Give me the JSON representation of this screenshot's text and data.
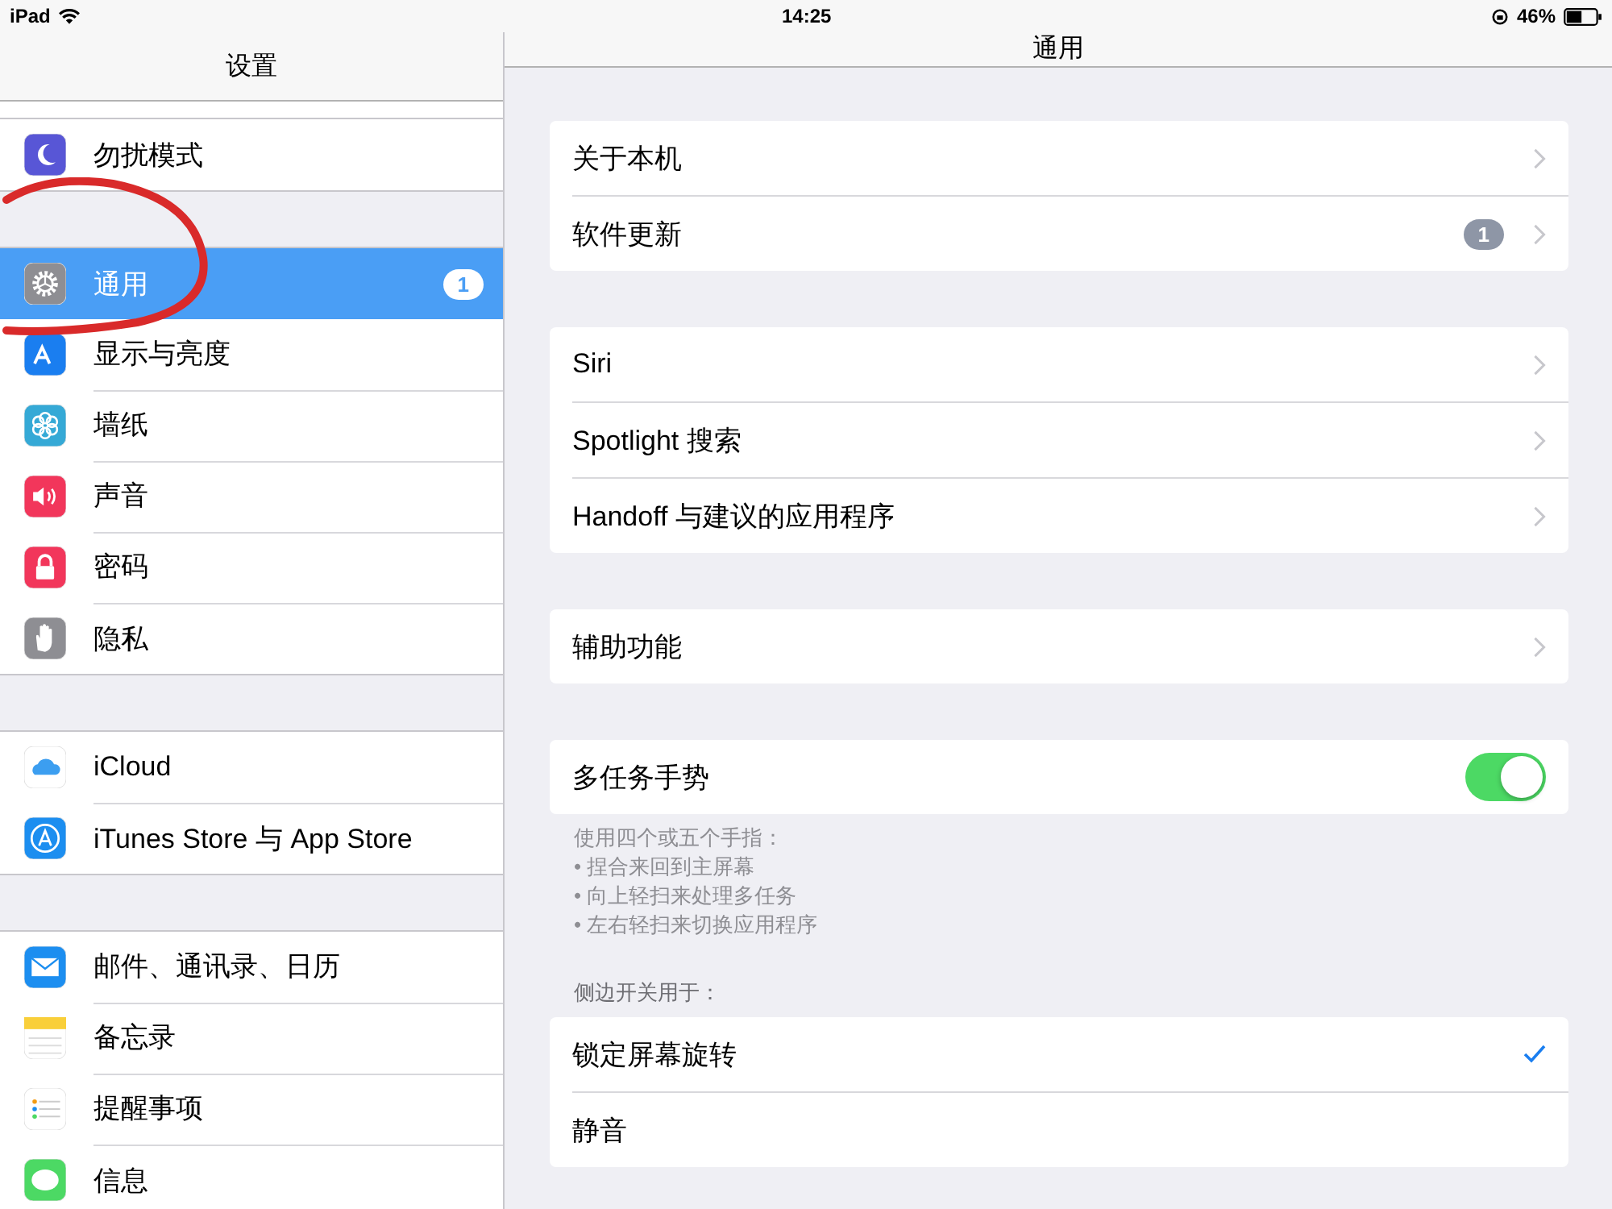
{
  "status_bar": {
    "device": "iPad",
    "time": "14:25",
    "battery": "46%"
  },
  "sidebar": {
    "title": "设置",
    "sections": [
      [
        {
          "label": "勿扰模式",
          "selected": false
        }
      ],
      [
        {
          "label": "通用",
          "selected": true,
          "badge": "1"
        },
        {
          "label": "显示与亮度",
          "selected": false
        },
        {
          "label": "墙纸",
          "selected": false
        },
        {
          "label": "声音",
          "selected": false
        },
        {
          "label": "密码",
          "selected": false
        },
        {
          "label": "隐私",
          "selected": false
        }
      ],
      [
        {
          "label": "iCloud",
          "selected": false
        },
        {
          "label": "iTunes Store 与 App Store",
          "selected": false
        }
      ],
      [
        {
          "label": "邮件、通讯录、日历",
          "selected": false
        },
        {
          "label": "备忘录",
          "selected": false
        },
        {
          "label": "提醒事项",
          "selected": false
        },
        {
          "label": "信息",
          "selected": false
        }
      ]
    ]
  },
  "detail": {
    "title": "通用",
    "groups": [
      {
        "rows": [
          {
            "kind": "link",
            "label": "关于本机"
          },
          {
            "kind": "link",
            "label": "软件更新",
            "badge": "1"
          }
        ]
      },
      {
        "rows": [
          {
            "kind": "link",
            "label": "Siri"
          },
          {
            "kind": "link",
            "label": "Spotlight 搜索"
          },
          {
            "kind": "link",
            "label": "Handoff 与建议的应用程序"
          }
        ]
      },
      {
        "rows": [
          {
            "kind": "link",
            "label": "辅助功能"
          }
        ]
      },
      {
        "rows": [
          {
            "kind": "toggle",
            "label": "多任务手势",
            "on": true
          }
        ],
        "footer": [
          "使用四个或五个手指：",
          "• 捏合来回到主屏幕",
          "• 向上轻扫来处理多任务",
          "• 左右轻扫来切换应用程序"
        ]
      },
      {
        "header": "侧边开关用于：",
        "rows": [
          {
            "kind": "option",
            "label": "锁定屏幕旋转",
            "checked": true
          },
          {
            "kind": "option",
            "label": "静音",
            "checked": false
          }
        ]
      }
    ]
  },
  "annotation": {
    "kind": "circle"
  }
}
